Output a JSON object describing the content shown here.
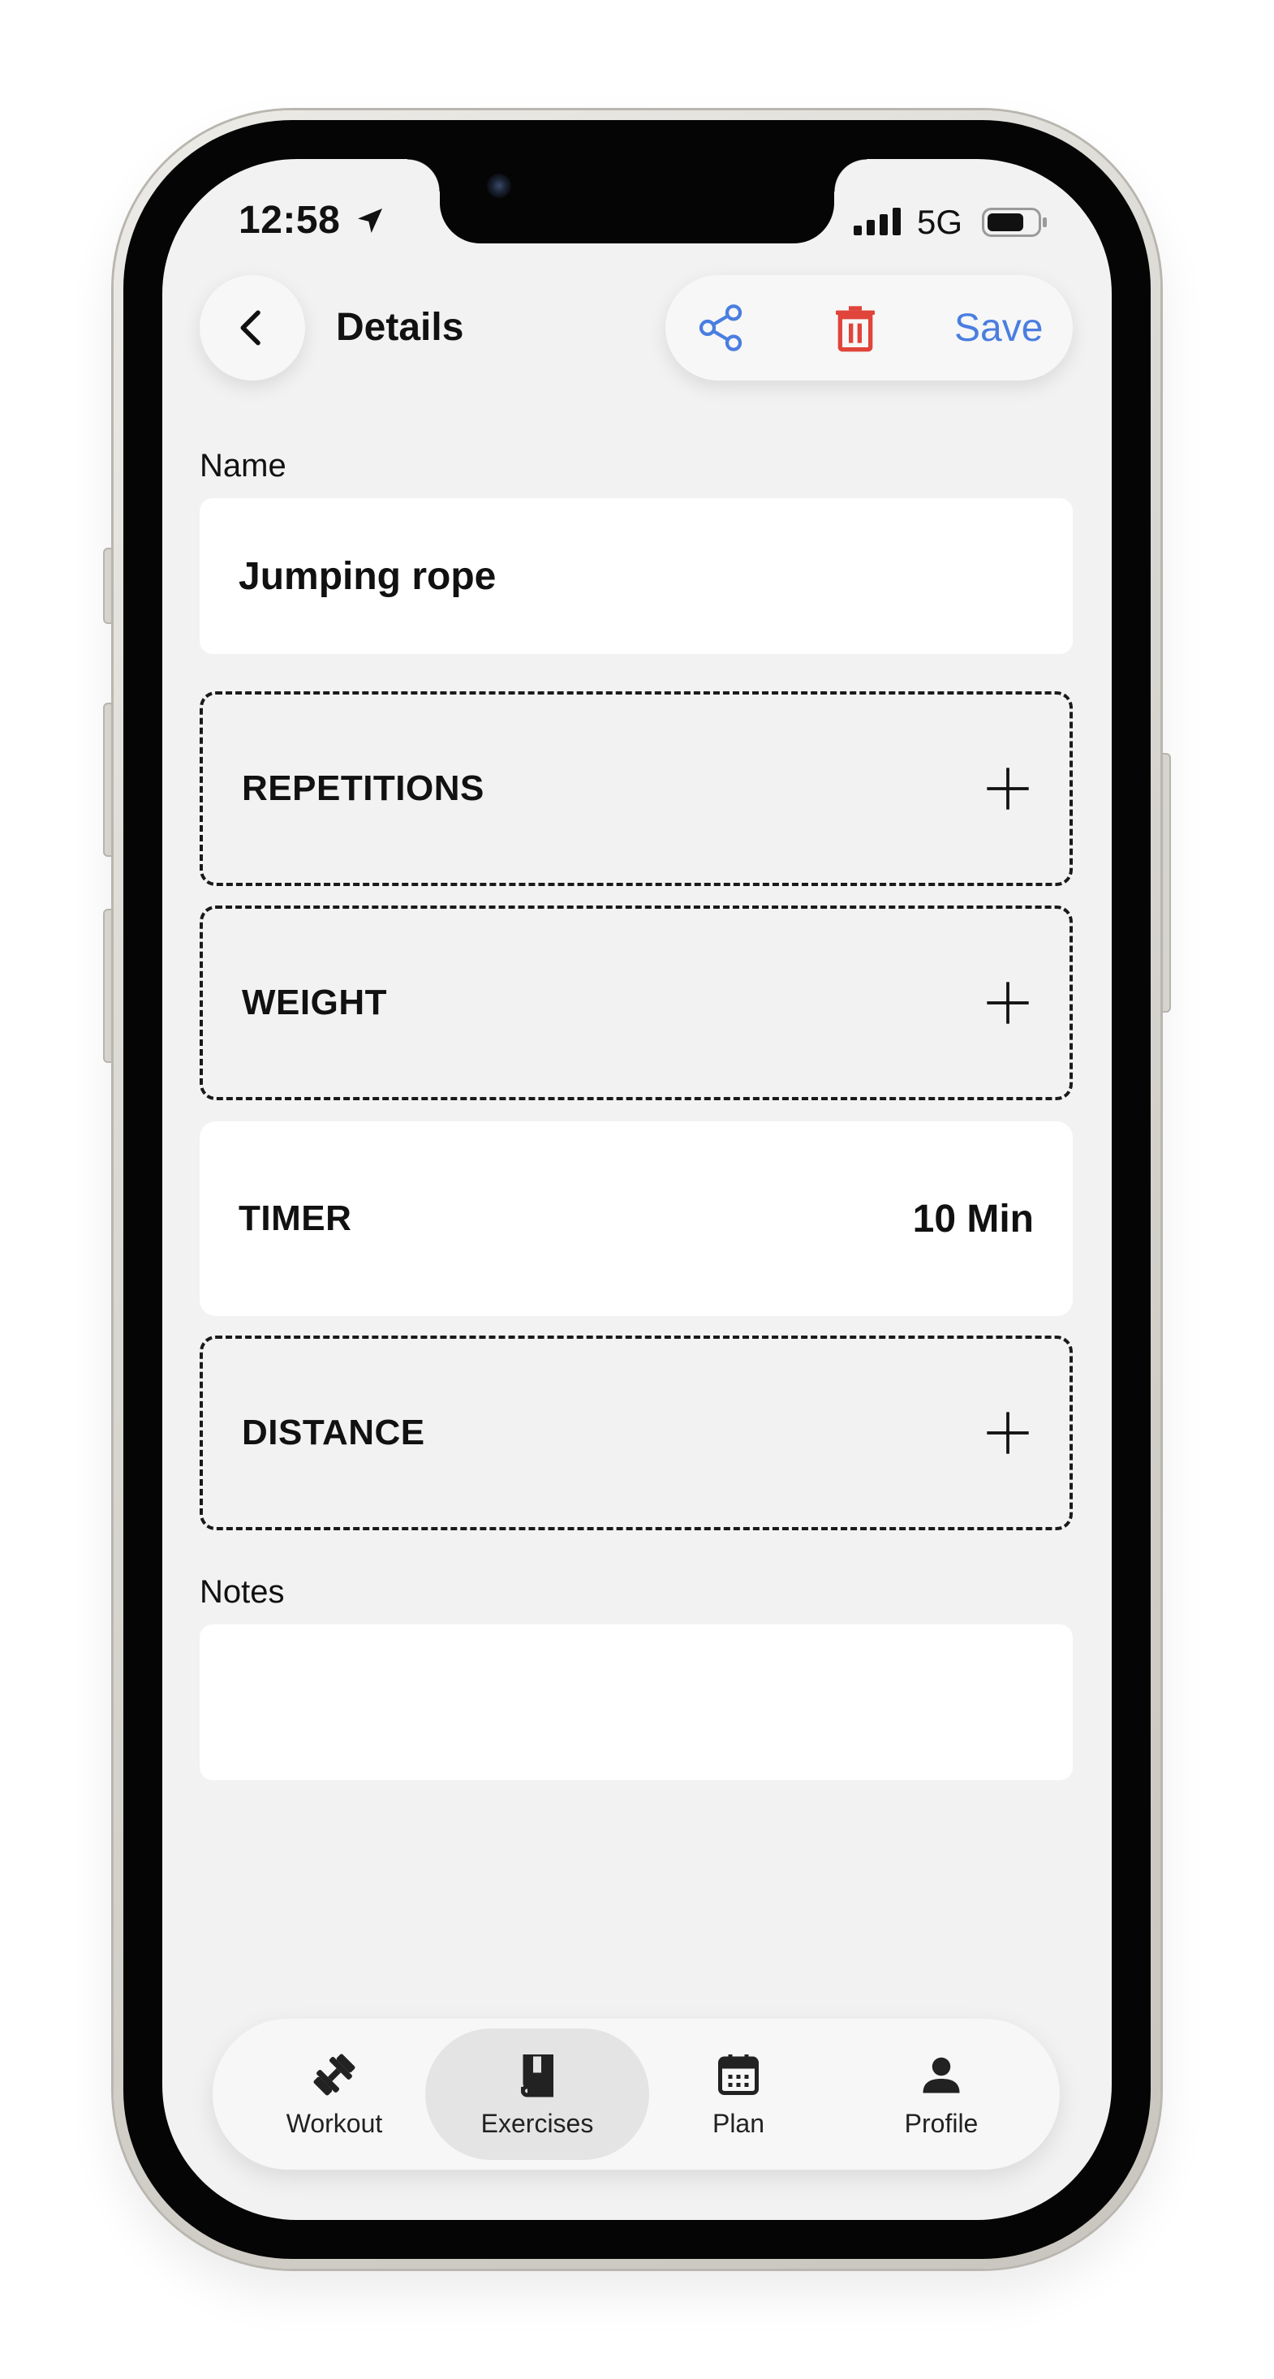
{
  "status_bar": {
    "time": "12:58",
    "network": "5G",
    "location_icon": "location-arrow-icon",
    "signal_icon": "cellular-signal-icon",
    "battery_icon": "battery-icon"
  },
  "header": {
    "back_icon": "chevron-left-icon",
    "title": "Details",
    "share_icon": "share-icon",
    "delete_icon": "trash-icon",
    "save_label": "Save",
    "accent_color": "#4a7ee0",
    "delete_color": "#e0443a"
  },
  "form": {
    "name_label": "Name",
    "name_value": "Jumping rope",
    "metrics": [
      {
        "label": "REPETITIONS",
        "state": "empty",
        "icon": "plus-icon"
      },
      {
        "label": "WEIGHT",
        "state": "empty",
        "icon": "plus-icon"
      },
      {
        "label": "TIMER",
        "state": "set",
        "value": "10 Min"
      },
      {
        "label": "DISTANCE",
        "state": "empty",
        "icon": "plus-icon"
      }
    ],
    "notes_label": "Notes",
    "notes_value": ""
  },
  "tab_bar": {
    "items": [
      {
        "label": "Workout",
        "icon": "dumbbell-icon",
        "active": false
      },
      {
        "label": "Exercises",
        "icon": "book-icon",
        "active": true
      },
      {
        "label": "Plan",
        "icon": "calendar-icon",
        "active": false
      },
      {
        "label": "Profile",
        "icon": "person-icon",
        "active": false
      }
    ]
  }
}
